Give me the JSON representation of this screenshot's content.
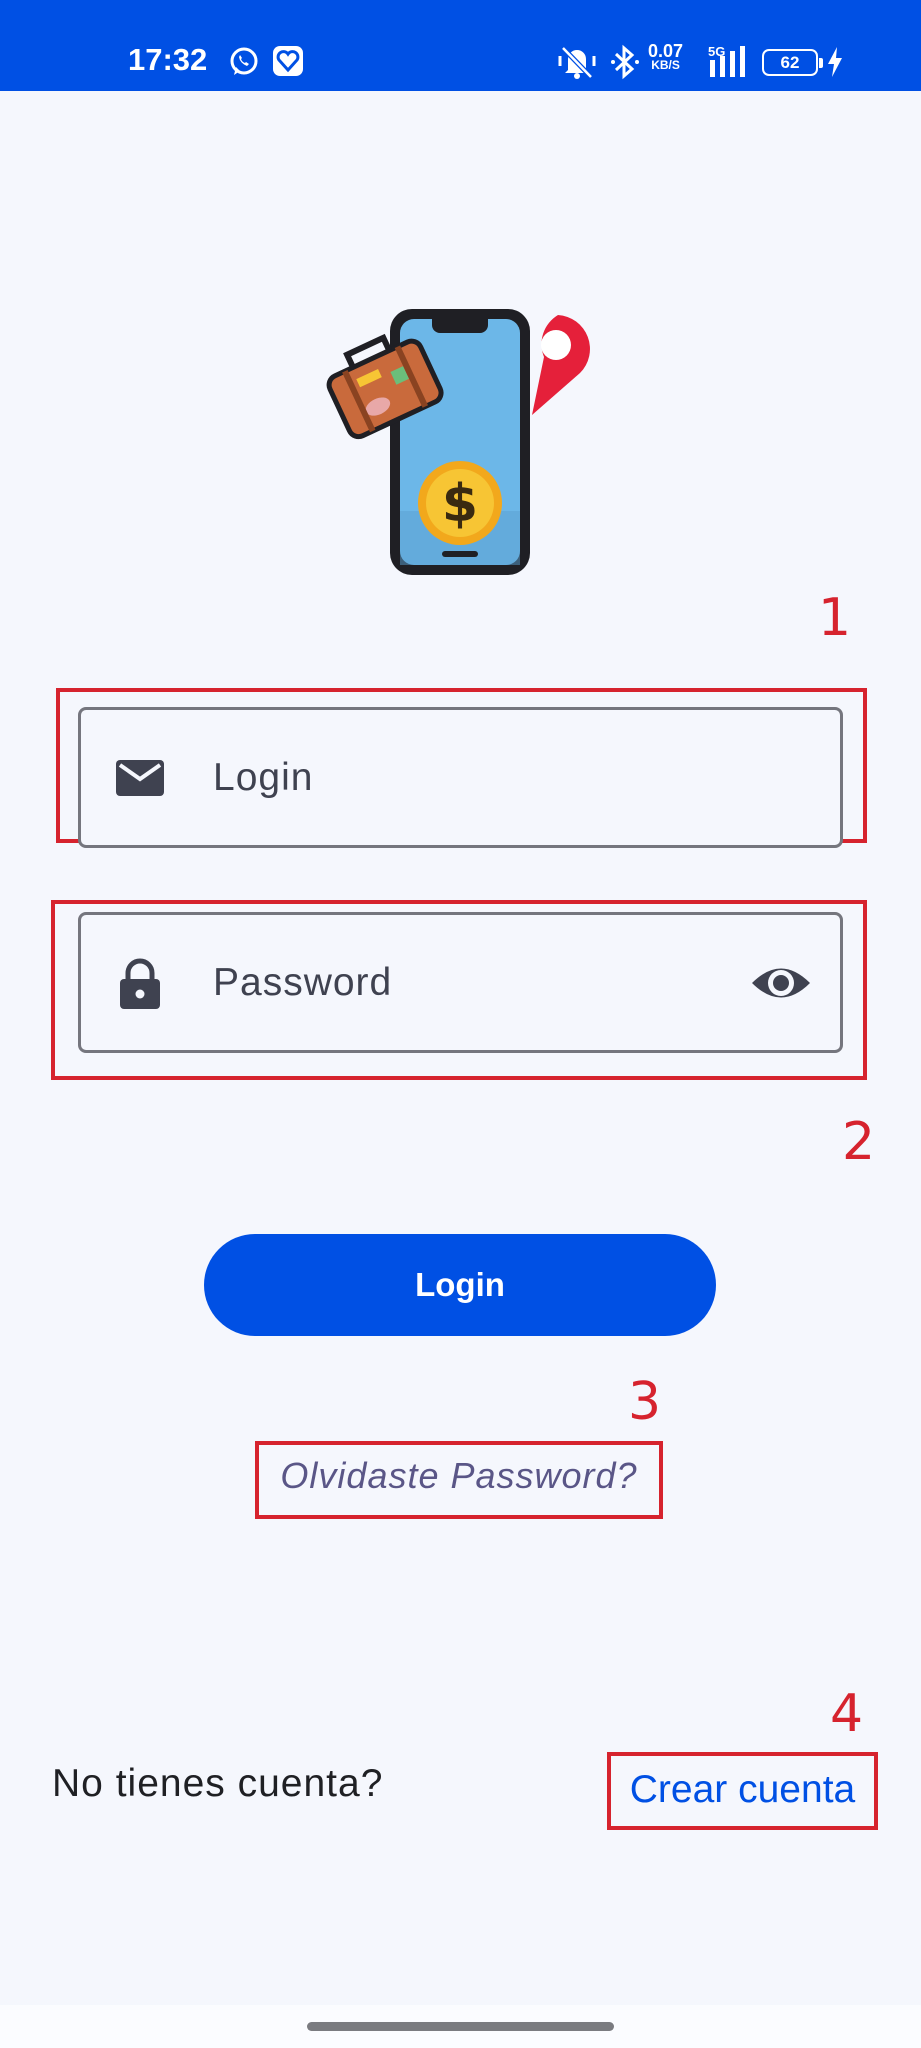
{
  "status_bar": {
    "time": "17:32",
    "network_speed_value": "0.07",
    "network_speed_unit": "KB/S",
    "network_type": "5G",
    "battery_level": "62",
    "icons": [
      "whatsapp-icon",
      "heart-app-icon",
      "mute-vibrate-icon",
      "bluetooth-icon",
      "signal-icon",
      "battery-icon",
      "charging-icon"
    ]
  },
  "logo": {
    "icon": "travel-expense-phone-icon"
  },
  "form": {
    "login_placeholder": "Login",
    "login_icon": "mail-icon",
    "password_placeholder": "Password",
    "password_icon": "lock-icon",
    "password_toggle_icon": "eye-icon",
    "submit_label": "Login",
    "forgot_label": "Olvidaste Password?"
  },
  "footer": {
    "prompt": "No tienes cuenta?",
    "create_label": "Crear cuenta"
  },
  "annotations": [
    "1",
    "2",
    "3",
    "4"
  ],
  "colors": {
    "primary": "#0050e4",
    "background": "#f5f7fd",
    "annotation": "#d6232e",
    "forgot_text": "#5a5687"
  }
}
